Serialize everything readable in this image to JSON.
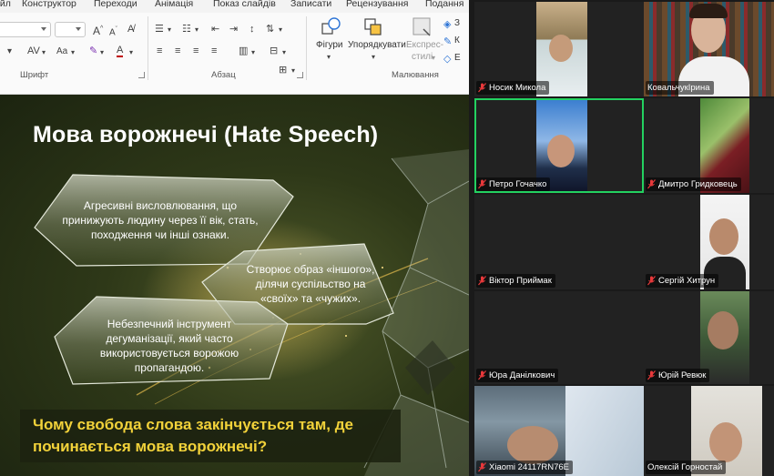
{
  "ribbon": {
    "tabs": [
      "Файл",
      "Конструктор",
      "Переходи",
      "Анімація",
      "Показ слайдів",
      "Записати",
      "Рецензування",
      "Подання"
    ],
    "groups": {
      "font": "Шрифт",
      "paragraph": "Абзац",
      "drawing": "Малювання"
    },
    "buttons": {
      "shapes": "Фігури",
      "arrange": "Упорядкувати",
      "styles_line1": "Експрес-",
      "styles_line2": "стилі"
    }
  },
  "slide": {
    "title": "Мова ворожнечі (Hate Speech)",
    "panels": [
      "Агресивні висловлювання, що принижують людину через її вік, стать, походження чи інші ознаки.",
      "Створює образ «іншого», ділячи суспільство на «своїх» та «чужих».",
      "Небезпечний інструмент дегуманізації, який часто використовується ворожою пропагандою."
    ],
    "question": "Чому свобода слова закінчується там, де починається мова ворожнечі?"
  },
  "gallery": {
    "participants": [
      {
        "name": "Носик Микола",
        "muted": true
      },
      {
        "name": "КовальчукІрина",
        "muted": false
      },
      {
        "name": "Петро Гочачко",
        "muted": true
      },
      {
        "name": "Дмитро Гридковець",
        "muted": true
      },
      {
        "name": "Віктор Приймак",
        "muted": true
      },
      {
        "name": "Сергій Хитрун",
        "muted": true
      },
      {
        "name": "Юра Данілкович",
        "muted": true
      },
      {
        "name": "Юрій Ревюк",
        "muted": true
      },
      {
        "name": "Xiaomi 24117RN76E",
        "muted": true
      },
      {
        "name": "Олексій Горностай",
        "muted": false
      }
    ],
    "colors": {
      "active_speaker": "#23d160",
      "muted_icon": "#e8393b"
    }
  }
}
